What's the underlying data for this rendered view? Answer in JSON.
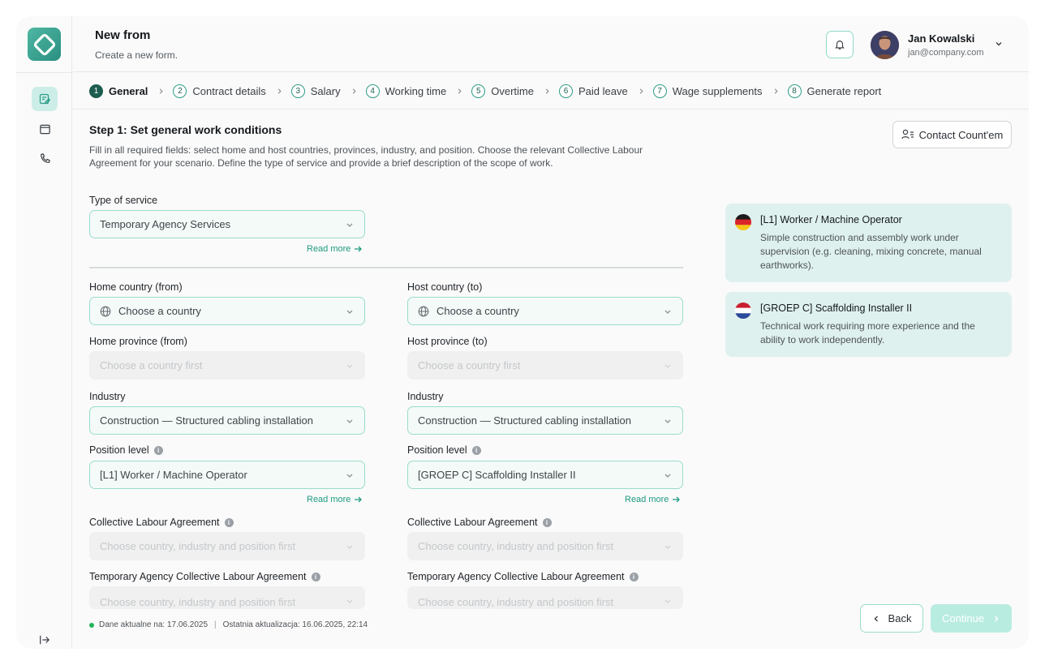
{
  "header": {
    "title": "New from",
    "subtitle": "Create a new form.",
    "user": {
      "name": "Jan Kowalski",
      "email": "jan@company.com"
    }
  },
  "steps": [
    {
      "num": "1",
      "label": "General",
      "active": true
    },
    {
      "num": "2",
      "label": "Contract details"
    },
    {
      "num": "3",
      "label": "Salary"
    },
    {
      "num": "4",
      "label": "Working time"
    },
    {
      "num": "5",
      "label": "Overtime"
    },
    {
      "num": "6",
      "label": "Paid leave"
    },
    {
      "num": "7",
      "label": "Wage supplements"
    },
    {
      "num": "8",
      "label": "Generate report"
    }
  ],
  "section": {
    "title": "Step 1: Set general work conditions",
    "description": "Fill in all required fields: select home and host countries, provinces, industry, and position. Choose the relevant Collective Labour Agreement for your scenario. Define the type of service and provide a brief description of the scope of work.",
    "contact_label": "Contact Count'em"
  },
  "form": {
    "service": {
      "label": "Type of service",
      "value": "Temporary Agency Services",
      "read_more": "Read more"
    },
    "home": {
      "country_label": "Home country (from)",
      "country_value": "Choose a country",
      "province_label": "Home province (from)",
      "province_value": "Choose a country first",
      "industry_label": "Industry",
      "industry_value": "Construction — Structured cabling installation",
      "position_label": "Position level",
      "position_value": "[L1] Worker / Machine Operator",
      "read_more": "Read more",
      "cla_label": "Collective Labour Agreement",
      "cla_value": "Choose country, industry and position first",
      "tcla_label": "Temporary Agency Collective Labour Agreement",
      "tcla_value": "Choose country, industry and position first"
    },
    "host": {
      "country_label": "Host country (to)",
      "country_value": "Choose a country",
      "province_label": "Host province (to)",
      "province_value": "Choose a country first",
      "industry_label": "Industry",
      "industry_value": "Construction — Structured cabling installation",
      "position_label": "Position level",
      "position_value": "[GROEP C] Scaffolding Installer II",
      "read_more": "Read more",
      "cla_label": "Collective Labour Agreement",
      "cla_value": "Choose country, industry and position first",
      "tcla_label": "Temporary Agency Collective Labour Agreement",
      "tcla_value": "Choose country, industry and position first"
    }
  },
  "cards": [
    {
      "flag": "germany-flag-icon",
      "title": "[L1] Worker / Machine Operator",
      "description": "Simple construction and assembly work under supervision (e.g. cleaning, mixing concrete, manual earthworks)."
    },
    {
      "flag": "netherlands-flag-icon",
      "title": "[GROEP C] Scaffolding Installer II",
      "description": "Technical work requiring more experience and the ability to work independently."
    }
  ],
  "footer": {
    "status_left": "Dane aktualne na: 17.06.2025",
    "separator": "|",
    "status_right": "Ostatnia aktualizacja: 16.06.2025, 22:14",
    "back_label": "Back",
    "continue_label": "Continue"
  },
  "colors": {
    "accent": "#2e9c86",
    "accent_light": "#dff1ee",
    "status_dot": "#23b35a"
  }
}
